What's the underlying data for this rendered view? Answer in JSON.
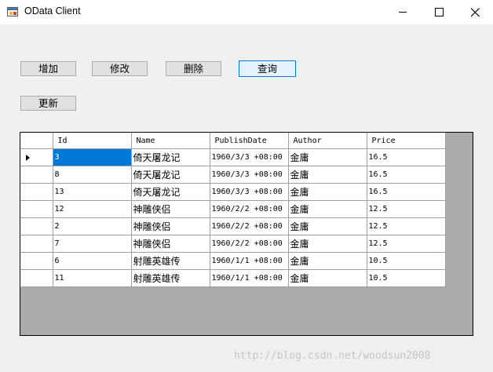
{
  "window": {
    "title": "OData Client"
  },
  "toolbar": {
    "add_label": "增加",
    "edit_label": "修改",
    "delete_label": "删除",
    "query_label": "查询",
    "refresh_label": "更新"
  },
  "grid": {
    "columns": [
      "Id",
      "Name",
      "PublishDate",
      "Author",
      "Price"
    ],
    "rows": [
      {
        "id": "3",
        "name": "倚天屠龙记",
        "publish_date": "1960/3/3 +08:00",
        "author": "金庸",
        "price": "16.5"
      },
      {
        "id": "8",
        "name": "倚天屠龙记",
        "publish_date": "1960/3/3 +08:00",
        "author": "金庸",
        "price": "16.5"
      },
      {
        "id": "13",
        "name": "倚天屠龙记",
        "publish_date": "1960/3/3 +08:00",
        "author": "金庸",
        "price": "16.5"
      },
      {
        "id": "12",
        "name": "神雕侠侣",
        "publish_date": "1960/2/2 +08:00",
        "author": "金庸",
        "price": "12.5"
      },
      {
        "id": "2",
        "name": "神雕侠侣",
        "publish_date": "1960/2/2 +08:00",
        "author": "金庸",
        "price": "12.5"
      },
      {
        "id": "7",
        "name": "神雕侠侣",
        "publish_date": "1960/2/2 +08:00",
        "author": "金庸",
        "price": "12.5"
      },
      {
        "id": "6",
        "name": "射雕英雄传",
        "publish_date": "1960/1/1 +08:00",
        "author": "金庸",
        "price": "10.5"
      },
      {
        "id": "11",
        "name": "射雕英雄传",
        "publish_date": "1960/1/1 +08:00",
        "author": "金庸",
        "price": "10.5"
      }
    ]
  },
  "watermark": "http://blog.csdn.net/woodsun2008",
  "colors": {
    "selection": "#0078d7",
    "grid_background": "#ababab",
    "window_background": "#f0f0f0"
  }
}
